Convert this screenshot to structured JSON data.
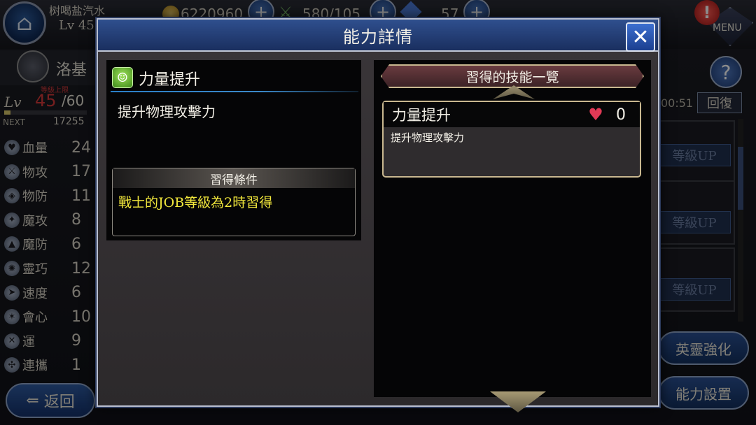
{
  "topbar": {
    "player_name": "树喝盐汽水",
    "player_level": "Lv 45",
    "gold": "6220960",
    "stamina": "580/105",
    "gems": "57",
    "menu_label": "MENU"
  },
  "character": {
    "name": "洛基",
    "lv_label": "Lv",
    "lv_cap_label": "等級上限",
    "level": "45",
    "level_max": "/60",
    "exp_fraction": 0.08,
    "next_label": "NEXT",
    "next_value": "17255",
    "stats": [
      {
        "icon": "heart-icon",
        "name": "血量",
        "value": "24"
      },
      {
        "icon": "sword-icon",
        "name": "物攻",
        "value": "17"
      },
      {
        "icon": "shield-icon",
        "name": "物防",
        "value": "11"
      },
      {
        "icon": "wand-icon",
        "name": "魔攻",
        "value": "8"
      },
      {
        "icon": "magic-shield-icon",
        "name": "魔防",
        "value": "6"
      },
      {
        "icon": "spiral-icon",
        "name": "靈巧",
        "value": "12"
      },
      {
        "icon": "boot-icon",
        "name": "速度",
        "value": "6"
      },
      {
        "icon": "critical-icon",
        "name": "會心",
        "value": "10"
      },
      {
        "icon": "luck-icon",
        "name": "運",
        "value": "9"
      },
      {
        "icon": "chain-icon",
        "name": "連攜",
        "value": "1"
      }
    ],
    "back_label": "返回"
  },
  "right_side": {
    "timer": "00:51",
    "recover_label": "回復",
    "levelup_label": "等級UP",
    "enhance_label": "英靈強化",
    "ability_setting_label": "能力設置"
  },
  "modal": {
    "title": "能力詳情",
    "close_symbol": "✕",
    "ability": {
      "name": "力量提升",
      "description": "提升物理攻擊力",
      "condition_header": "習得條件",
      "condition_text": "戰士的JOB等級為2時習得"
    },
    "skills_header": "習得的技能一覽",
    "skills": [
      {
        "name": "力量提升",
        "count": "0",
        "description": "提升物理攻擊力"
      }
    ]
  },
  "colors": {
    "accent_blue": "#2f4f8e",
    "condition_yellow": "#f2e83c",
    "card_border_gold": "#c9b890",
    "level_red": "#d83a3a"
  }
}
